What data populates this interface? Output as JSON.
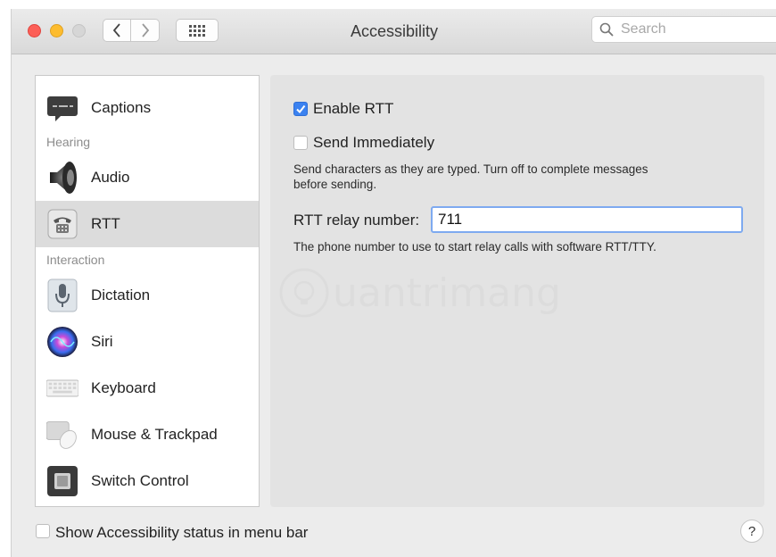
{
  "window": {
    "title": "Accessibility",
    "search_placeholder": "Search"
  },
  "sidebar": {
    "items": [
      {
        "label": "Captions",
        "icon": "captions-icon"
      },
      {
        "label": "Audio",
        "icon": "speaker-icon"
      },
      {
        "label": "RTT",
        "icon": "phone-icon"
      },
      {
        "label": "Dictation",
        "icon": "microphone-icon"
      },
      {
        "label": "Siri",
        "icon": "siri-icon"
      },
      {
        "label": "Keyboard",
        "icon": "keyboard-icon"
      },
      {
        "label": "Mouse & Trackpad",
        "icon": "mouse-icon"
      },
      {
        "label": "Switch Control",
        "icon": "switch-icon"
      }
    ],
    "sections": [
      "Hearing",
      "Interaction"
    ],
    "selected": "RTT"
  },
  "panel": {
    "enable_rtt": {
      "label": "Enable RTT",
      "checked": true
    },
    "send_immediately": {
      "label": "Send Immediately",
      "checked": false
    },
    "send_description_line1": "Send characters as they are typed. Turn off to complete messages",
    "send_description_line2": "before sending.",
    "relay_label": "RTT relay number:",
    "relay_value": "711",
    "relay_description": "The phone number to use to start relay calls with software RTT/TTY."
  },
  "footer": {
    "status_label": "Show Accessibility status in menu bar",
    "status_checked": false,
    "help": "?"
  },
  "watermark": "uantrimang",
  "colors": {
    "accent": "#3b82f0",
    "close": "#fc5f57",
    "minimize": "#fdbc2e"
  }
}
